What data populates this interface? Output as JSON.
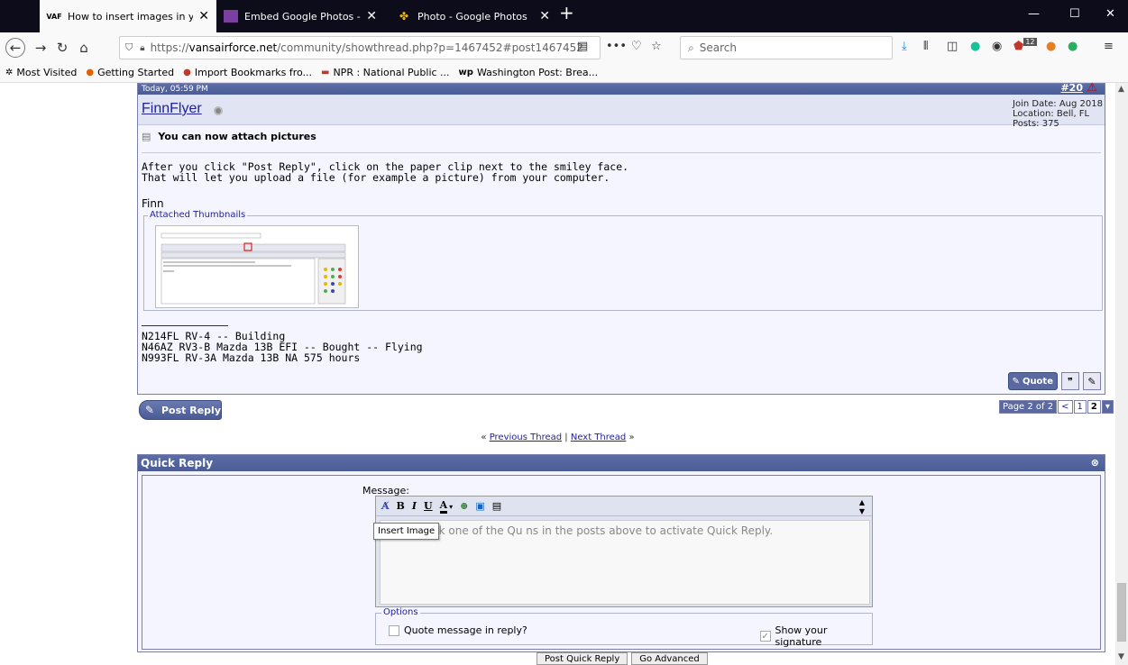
{
  "browser": {
    "tabs": [
      {
        "favicon": "VAF",
        "title": "How to insert images in your p",
        "active": true
      },
      {
        "favicon": "",
        "title": "Embed Google Photos - Add In",
        "active": false
      },
      {
        "favicon": "",
        "title": "Photo - Google Photos",
        "active": false
      }
    ],
    "url_prefix": "https://",
    "url_host": "vansairforce.net",
    "url_path": "/community/showthread.php?p=1467452#post1467452",
    "search_placeholder": "Search",
    "addon_badge": "12",
    "bookmarks": [
      "Most Visited",
      "Getting Started",
      "Import Bookmarks fro...",
      "NPR : National Public ...",
      "Washington Post: Brea..."
    ]
  },
  "post": {
    "date": "Today, 05:59 PM",
    "number": "#20",
    "username": "FinnFlyer",
    "join_date": "Join Date: Aug 2018",
    "location": "Location: Bell, FL",
    "posts": "Posts: 375",
    "title": "You can now attach pictures",
    "body_line1": "After you click \"Post Reply\", click on the paper clip next to the smiley face.",
    "body_line2": "That will let you upload a file (for example a picture) from your computer.",
    "sign_name": "Finn",
    "attachments_label": "Attached Thumbnails",
    "signature": [
      "N214FL RV-4 -- Building",
      "N46AZ RV3-B Mazda 13B EFI -- Bought -- Flying",
      "N993FL RV-3A Mazda 13B NA 575 hours"
    ],
    "quote_label": "Quote"
  },
  "thread": {
    "post_reply": "Post Reply",
    "page_label": "Page 2 of 2",
    "pages": [
      "<",
      "1",
      "2"
    ],
    "prev_thread": "Previous Thread",
    "next_thread": "Next Thread",
    "sep": "|"
  },
  "quick_reply": {
    "title": "Quick Reply",
    "message_label": "Message:",
    "textarea_text": "Please click one of the Qu                 ns in the posts above to activate Quick Reply.",
    "tooltip": "Insert Image",
    "options_label": "Options",
    "quote_option": "Quote message in reply?",
    "signature_option": "Show your signature",
    "post_button": "Post Quick Reply",
    "advanced_button": "Go Advanced"
  }
}
